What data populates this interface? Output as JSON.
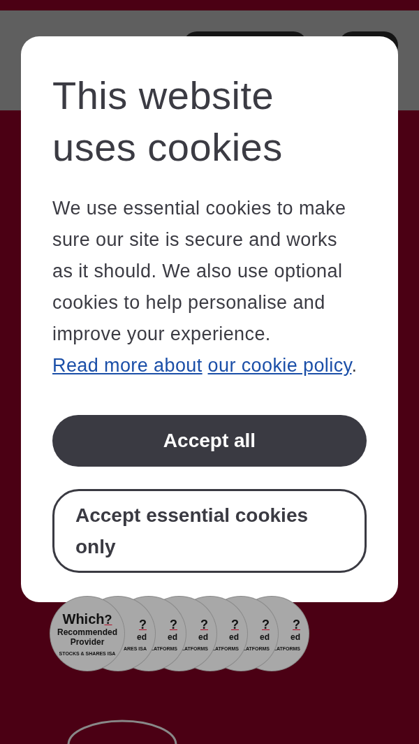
{
  "dialog": {
    "title": "This website uses cookies",
    "body": "We use essential cookies to make sure our site is secure and works as it should. We also use optional cookies to help personalise and improve your experience. ",
    "link": [
      "Read more about",
      "our cookie policy"
    ],
    "after_link": ".",
    "buttons": [
      {
        "label": "Accept all",
        "kind": "primary"
      },
      {
        "label": "Accept essential cookies only",
        "kind": "outline"
      }
    ]
  },
  "badges": [
    {
      "brand": "Which",
      "mark": "?",
      "title": "Recommended Provider",
      "category": "STOCKS & SHARES ISA"
    },
    {
      "mark": "?",
      "title": "ed",
      "category": "ARES ISA"
    },
    {
      "mark": "?",
      "title": "ed",
      "category": "LATFORMS"
    },
    {
      "mark": "?",
      "title": "ed",
      "category": "LATFORMS"
    },
    {
      "mark": "?",
      "title": "ed",
      "category": "LATFORMS"
    },
    {
      "mark": "?",
      "title": "ed",
      "category": "LATFORMS"
    },
    {
      "mark": "?",
      "title": "ed",
      "category": "LATFORMS"
    }
  ]
}
